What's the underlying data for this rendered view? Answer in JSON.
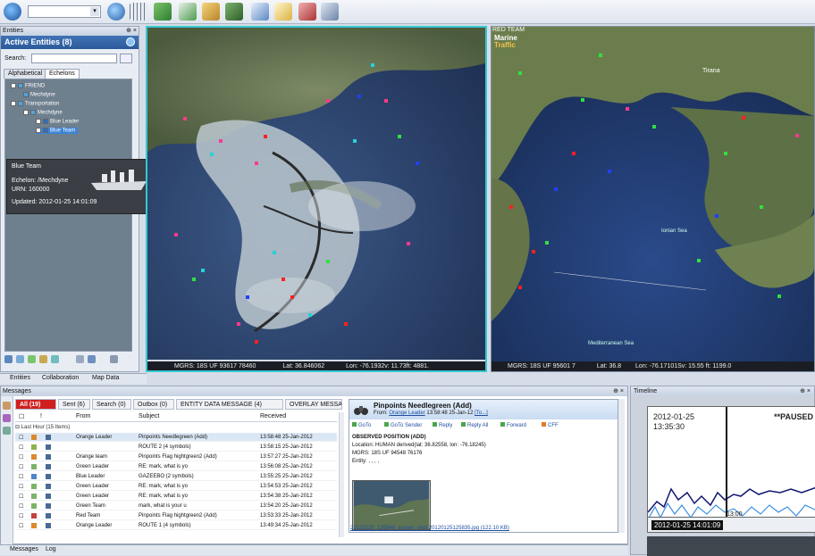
{
  "entities_panel": {
    "title": "Entities",
    "heading": "Active Entities (8)",
    "search_label": "Search:",
    "tabs": [
      "Alphabetical",
      "Echelons"
    ],
    "tree": [
      {
        "label": "FRIEND"
      },
      {
        "label": "Mechdyne"
      },
      {
        "label": "Transportation"
      },
      {
        "label": "Mechdyne"
      },
      {
        "label": "Blue Leader"
      },
      {
        "label": "Blue Team"
      }
    ],
    "tooltip": {
      "name": "Blue Team",
      "echelon": "Echelon: /Mechdyne",
      "urn": "URN: 160000",
      "updated": "Updated: 2012-01-25 14:01:09"
    },
    "bottom_tabs": [
      "Entities",
      "Collaboration",
      "Map Data"
    ]
  },
  "map_left": {
    "status": "MGRS:  18S UF 93617 78460",
    "lat": "Lat:  36.846062",
    "lon": "Lon:  -76.1932v: 11.73ft: 4881."
  },
  "map_right": {
    "title": "RED TEAM",
    "logo_line1": "Marine",
    "logo_line2": "Traffic",
    "status": "MGRS:  18S UF 95601 7",
    "lat": "Lat:  36.8",
    "lon": "Lon:  -76.17101Sv: 15.55 ft: 1199.0",
    "labels": [
      "Tirana",
      "Ionian Sea",
      "Mediterranean Sea"
    ]
  },
  "messages": {
    "title": "Messages",
    "tabs": [
      "All (19)",
      "Sent (6)",
      "Search (0)",
      "Outbox (0)",
      "ENTITY DATA MESSAGE (4)",
      "OVERLAY MESSA"
    ],
    "columns": {
      "from": "From",
      "subject": "Subject",
      "received": "Received"
    },
    "group": "Last Hour (15 Items)",
    "rows": [
      {
        "from": "Orange Leader",
        "subject": "Pinpoints Needlegreen (Add)",
        "received": "13:58:48 25-Jan-2012"
      },
      {
        "from": "",
        "subject": "ROUTE 2   (4 symbols)",
        "received": "13:58:15 25-Jan-2012"
      },
      {
        "from": "Orange team",
        "subject": "Pinpoints Flag hightgreen2 (Add)",
        "received": "13:57:27 25-Jan-2012"
      },
      {
        "from": "Green Leader",
        "subject": "RE: mark, what is yo",
        "received": "13:56:08 25-Jan-2012"
      },
      {
        "from": "Blue Leader",
        "subject": "GAZEEBO   (2 symbols)",
        "received": "13:55:25 25-Jan-2012"
      },
      {
        "from": "Green Leader",
        "subject": "RE: mark, what is yo",
        "received": "13:54:53 25-Jan-2012"
      },
      {
        "from": "Green Leader",
        "subject": "RE: mark, what is yo",
        "received": "13:54:38 25-Jan-2012"
      },
      {
        "from": "Green Team",
        "subject": "mark, what is your u",
        "received": "13:54:20 25-Jan-2012"
      },
      {
        "from": "Red Team",
        "subject": "Pinpoints Flag hightgreen2 (Add)",
        "received": "13:53:33 25-Jan-2012"
      },
      {
        "from": "Orange Leader",
        "subject": "ROUTE 1   (4 symbols)",
        "received": "13:49:34 25-Jan-2012"
      }
    ],
    "bottom_tabs": [
      "Messages",
      "Log"
    ]
  },
  "detail": {
    "title": "Pinpoints Needlegreen (Add)",
    "from_label": "From:",
    "from_value": "Orange Leader",
    "time": "13:58:48 25-Jan-12",
    "to": "[To...]",
    "actions": [
      "GoTo",
      "GoTo Sender",
      "Reply",
      "Reply All",
      "Forward",
      "CFF"
    ],
    "observed": "OBSERVED POSITION (ADD)",
    "location": "Location: HUMAN derived(lat: 36.82558, lon: -76.18245)",
    "mgrs": "MGRS: 18S UF 94548 76176",
    "entity": "Entity: , , , ,",
    "attachment": "20120125_135848_screen_shot 20120125125835.jpg (122.10 KB)"
  },
  "timeline": {
    "title": "Timeline",
    "date": "2012-01-25",
    "time": "13:35:30",
    "status": "**PAUSED",
    "tick": "13:00",
    "current": "2012-01-25 14:01:09"
  }
}
